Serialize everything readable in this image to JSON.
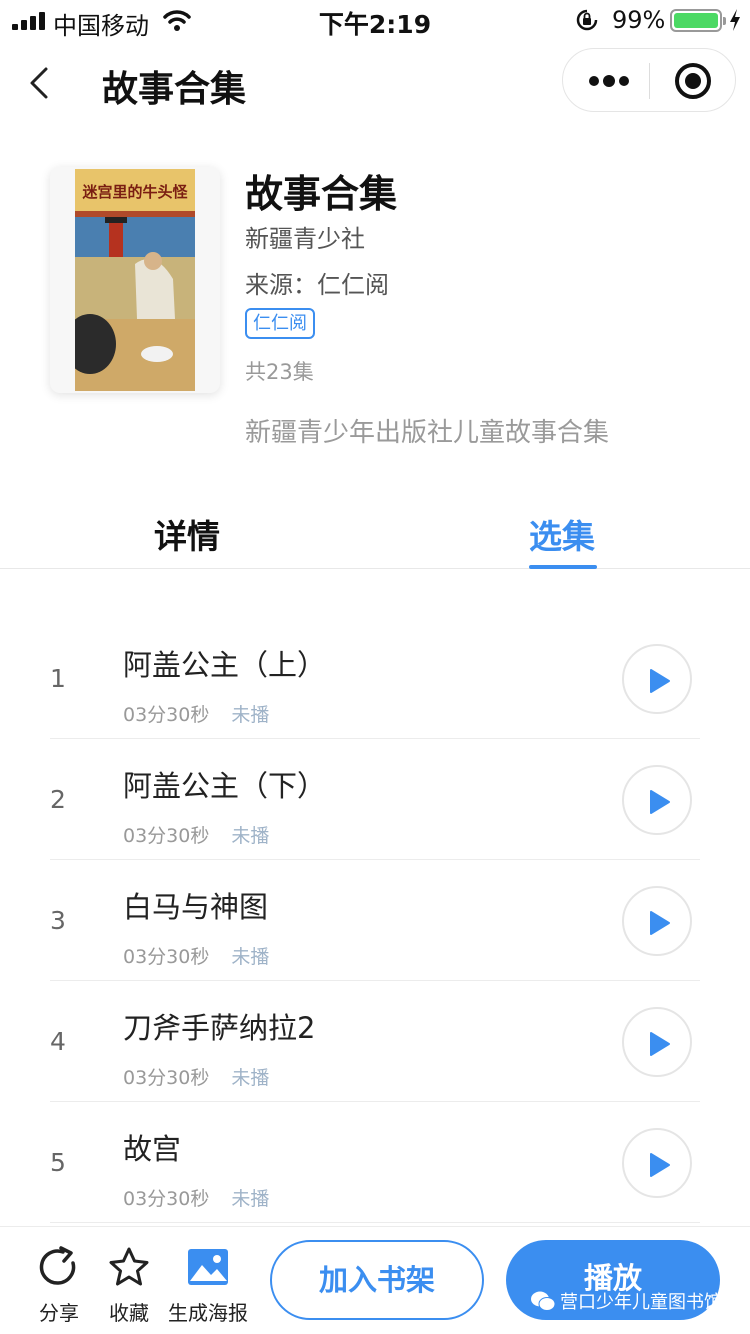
{
  "status_bar": {
    "carrier": "中国移动",
    "time": "下午2:19",
    "battery": "99%"
  },
  "nav": {
    "title": "故事合集"
  },
  "book": {
    "title": "故事合集",
    "cover_title": "迷宫里的牛头怪",
    "publisher": "新疆青少社",
    "source": "来源：仁仁阅",
    "tag": "仁仁阅",
    "total": "共23集",
    "description": "新疆青少年出版社儿童故事合集"
  },
  "tabs": {
    "details": "详情",
    "episodes": "选集",
    "active": "episodes"
  },
  "episodes": [
    {
      "number": "1",
      "title": "阿盖公主（上）",
      "duration": "03分30秒",
      "status": "未播"
    },
    {
      "number": "2",
      "title": "阿盖公主（下）",
      "duration": "03分30秒",
      "status": "未播"
    },
    {
      "number": "3",
      "title": "白马与神图",
      "duration": "03分30秒",
      "status": "未播"
    },
    {
      "number": "4",
      "title": "刀斧手萨纳拉2",
      "duration": "03分30秒",
      "status": "未播"
    },
    {
      "number": "5",
      "title": "故宫",
      "duration": "03分30秒",
      "status": "未播"
    }
  ],
  "bottom_bar": {
    "share": "分享",
    "favorite": "收藏",
    "poster": "生成海报",
    "add_to_shelf": "加入书架",
    "play": "播放"
  },
  "watermark": "营口少年儿童图书馆",
  "colors": {
    "accent": "#3b8ef0",
    "battery": "#4cd964"
  }
}
